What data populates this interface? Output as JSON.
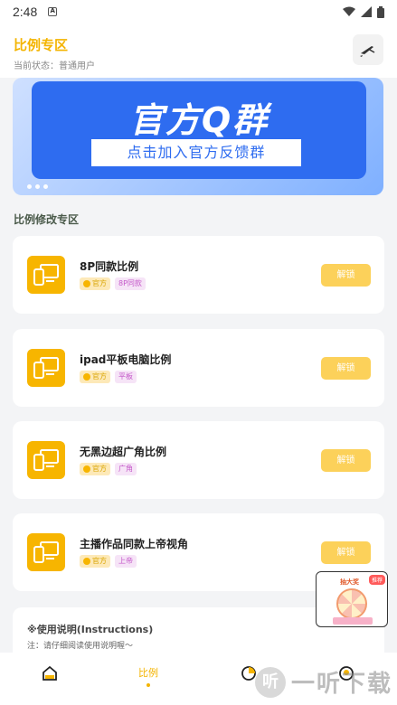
{
  "status_bar": {
    "time": "2:48",
    "notification_glyph": "A"
  },
  "header": {
    "title": "比例专区",
    "subtitle": "当前状态：普通用户"
  },
  "banner": {
    "title": "官方Q群",
    "subtitle": "点击加入官方反馈群"
  },
  "section": {
    "title": "比例修改专区"
  },
  "cards": [
    {
      "title": "8P同款比例",
      "official": "官方",
      "category": "8P同款",
      "button": "解锁"
    },
    {
      "title": "ipad平板电脑比例",
      "official": "官方",
      "category": "平板",
      "button": "解锁"
    },
    {
      "title": "无黑边超广角比例",
      "official": "官方",
      "category": "广角",
      "button": "解锁"
    },
    {
      "title": "主播作品同款上帝视角",
      "official": "官方",
      "category": "上帝",
      "button": "解锁"
    }
  ],
  "instructions": {
    "title": "※使用说明(Instructions)",
    "note": "注：请仔细阅读使用说明喔～"
  },
  "float_ad": {
    "label": "抽大奖",
    "badge": "推荐"
  },
  "bottom_nav": {
    "active_label": "比例"
  },
  "watermark": {
    "logo": "听",
    "text": "一听下载"
  },
  "colors": {
    "accent": "#f4b400",
    "banner_blue": "#2e6cf0",
    "unlock": "#fcd15a"
  },
  "icons": [
    "crossed-tools-icon",
    "phone-tablet-icon",
    "home-icon",
    "pie-chart-icon",
    "profile-icon"
  ]
}
